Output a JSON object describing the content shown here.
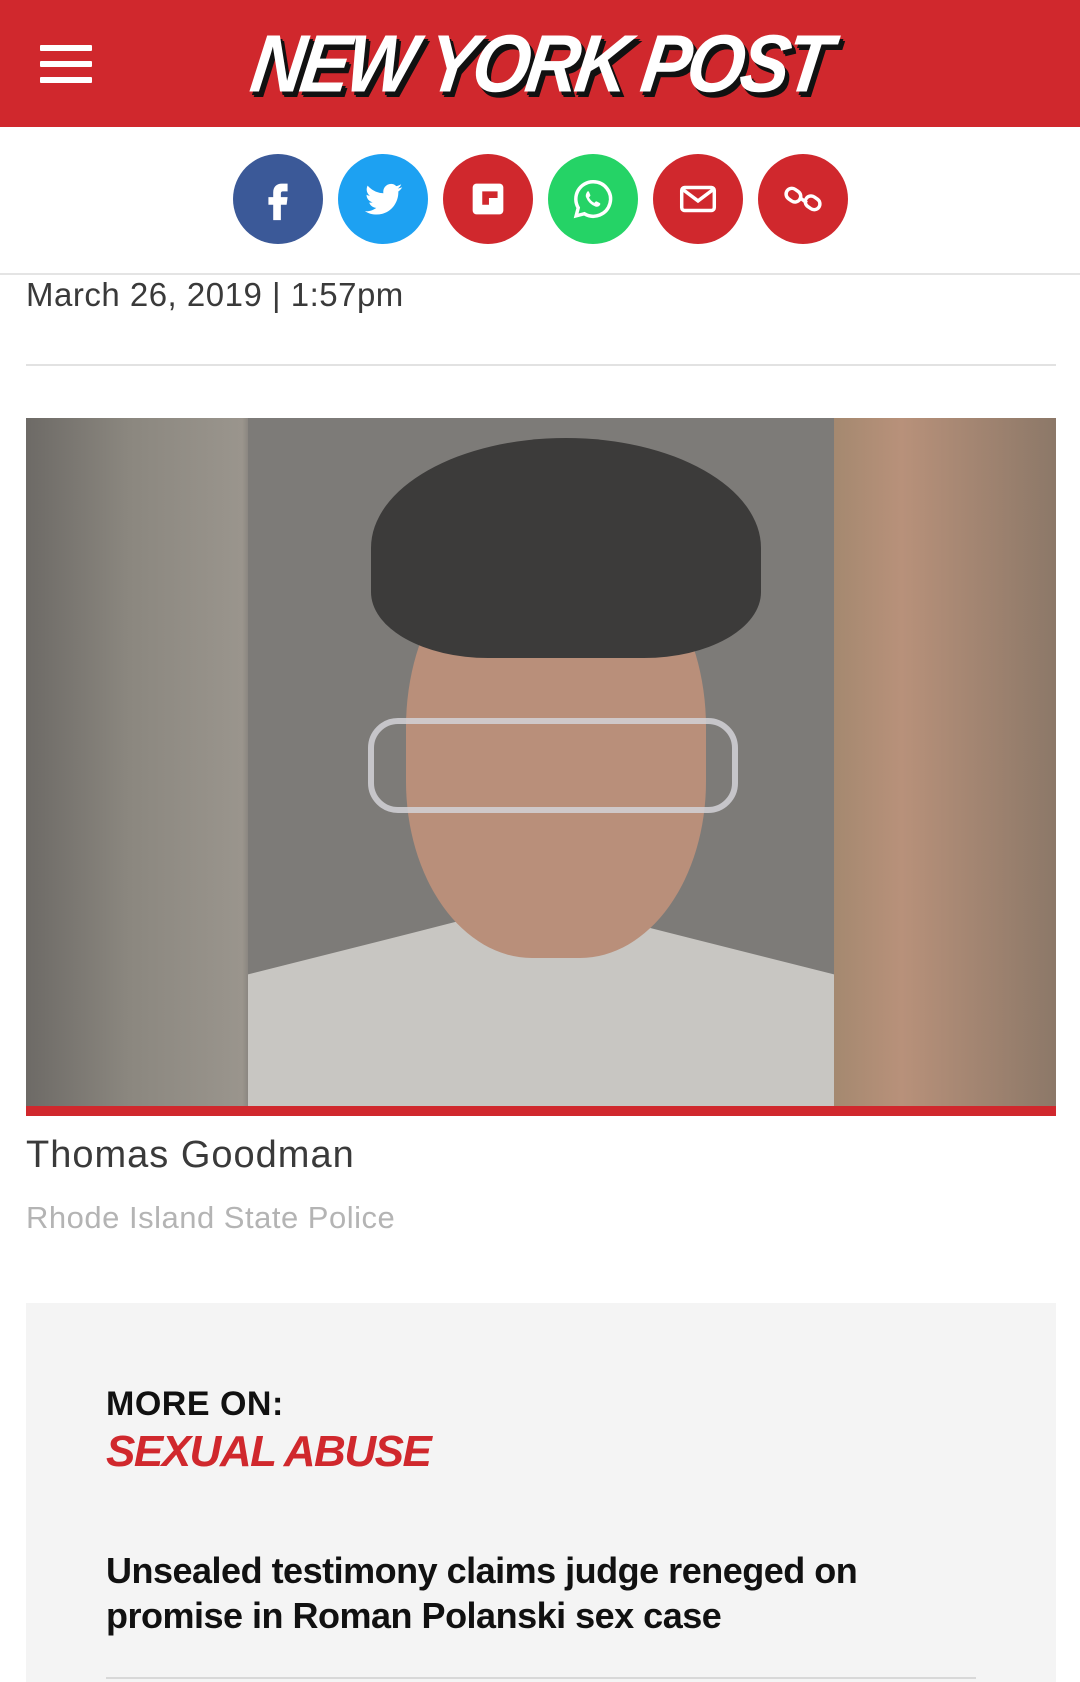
{
  "header": {
    "logo_text": "NEW YORK POST",
    "menu_icon": "hamburger-menu-icon",
    "brand_color": "#d0282d"
  },
  "share": {
    "buttons": [
      {
        "name": "facebook",
        "icon": "facebook-icon",
        "color": "#3b5998"
      },
      {
        "name": "twitter",
        "icon": "twitter-icon",
        "color": "#1da1f2"
      },
      {
        "name": "flipboard",
        "icon": "flipboard-icon",
        "color": "#d0282d"
      },
      {
        "name": "whatsapp",
        "icon": "whatsapp-icon",
        "color": "#25d366"
      },
      {
        "name": "email",
        "icon": "email-icon",
        "color": "#d0282d"
      },
      {
        "name": "copy-link",
        "icon": "link-icon",
        "color": "#d0282d"
      }
    ]
  },
  "article": {
    "dateline": "March 26, 2019 | 1:57pm",
    "photo": {
      "caption": "Thomas Goodman",
      "credit": "Rhode Island State Police"
    }
  },
  "more_on": {
    "label": "MORE ON:",
    "topic": "SEXUAL ABUSE",
    "headline": "Unsealed testimony claims judge reneged on promise in Roman Polanski sex case"
  }
}
